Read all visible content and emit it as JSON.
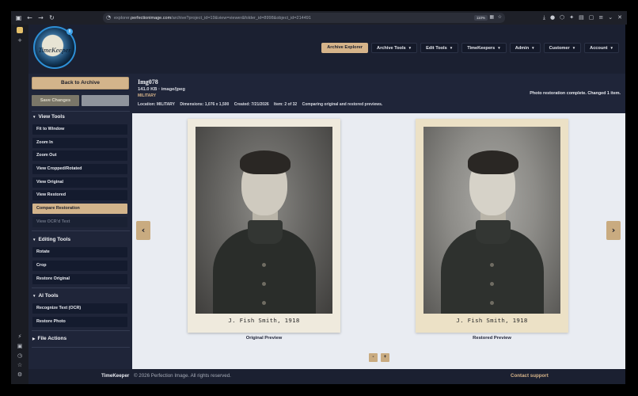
{
  "browser": {
    "url_prefix": "explorer.",
    "url_domain": "perfectionimage.com",
    "url_path": "/archive?project_id=19&view=viewer&folder_id=8998&object_id=214491",
    "zoom": "110%",
    "toolbar_icons": [
      "sidebar-icon",
      "back-icon",
      "forward-icon",
      "reload-icon"
    ]
  },
  "header": {
    "logo_text": "TimeKeeper",
    "logo_badge": "8",
    "nav": [
      {
        "label": "Archive Explorer",
        "active": true,
        "caret": ""
      },
      {
        "label": "Archive Tools",
        "caret": "▼"
      },
      {
        "label": "Edit Tools",
        "caret": "▼"
      },
      {
        "label": "TimeKeepers",
        "caret": "▼"
      },
      {
        "label": "Admin",
        "caret": "▼"
      },
      {
        "label": "Customer",
        "caret": "▼"
      },
      {
        "label": "Account",
        "caret": "▼"
      }
    ]
  },
  "sidebar": {
    "back_label": "Back to Archive",
    "save_label": "Save Changes",
    "view_tools_title": "View Tools",
    "view_tools": [
      "Fit to Window",
      "Zoom In",
      "Zoom Out",
      "View Cropped/Rotated",
      "View Original",
      "View Restored",
      "Compare Restoration",
      "View OCR'd Text"
    ],
    "editing_tools_title": "Editing Tools",
    "editing_tools": [
      "Rotate",
      "Crop",
      "Restore Original"
    ],
    "ai_tools_title": "AI Tools",
    "ai_tools": [
      "Recognize Text (OCR)",
      "Restore Photo"
    ],
    "file_actions_title": "File Actions",
    "expanded_marker": "▼",
    "collapsed_marker": "▶"
  },
  "info": {
    "title": "Img078",
    "size": "141.0 KB · image/jpeg",
    "category": "MILITARY",
    "location": "Location: MILITARY",
    "dimensions": "Dimensions: 1,076 x 1,500",
    "created": "Created: 7/21/2026",
    "item": "Item: 2 of 32",
    "comparing": "Comparing original and restored previews.",
    "status": "Photo restoration complete. Changed 1 item."
  },
  "viewer": {
    "prev_arrow": "‹",
    "next_arrow": "›",
    "caption": "J. Fish Smith, 1918",
    "original_label": "Original Preview",
    "restored_label": "Restored Preview",
    "zoom_out": "-",
    "zoom_in": "+"
  },
  "footer": {
    "brand": "TimeKeeper",
    "copyright": "© 2026 Perfection Image. All rights reserved.",
    "support": "Contact support"
  }
}
